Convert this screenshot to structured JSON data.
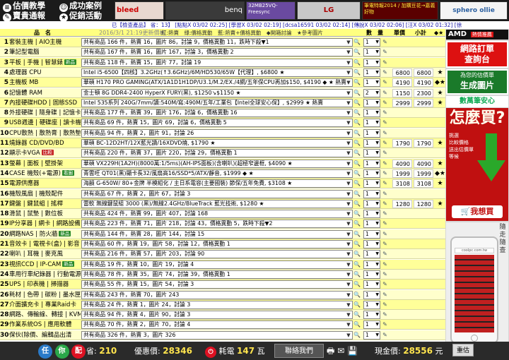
{
  "header": {
    "nav": [
      {
        "label": "估價教學",
        "icon": "document-icon"
      },
      {
        "label": "成功案例",
        "icon": "smiley-icon"
      },
      {
        "label": "賣貴通報",
        "icon": "edit-icon"
      },
      {
        "label": "促銷活動",
        "icon": "star-icon"
      }
    ],
    "ads": [
      {
        "text": "bleed",
        "bg": "#e8d8d0",
        "color": "#c00"
      },
      {
        "text": "benq",
        "bg": "#3a3a3a",
        "color": "#fff"
      },
      {
        "text": "32MB25VQ- Freesync",
        "bg": "#6a4aa0",
        "color": "#fff"
      },
      {
        "text": "LG",
        "bg": "#c8c8c8",
        "color": "#a00"
      },
      {
        "text": "筆電特報2014 / 加購豆花→嘉義好物",
        "bg": "#5a0000",
        "color": "#ffeb3b"
      },
      {
        "text": "sphero ollie",
        "bg": "#f4f4f4",
        "color": "#2a5fa0"
      }
    ],
    "info": "已【檢查產品】 省：13】 [點點X 03/02 02:25] [學習X 03/02 02:19] [dcsa16591 03/02 02:14] [傳說X 03/02 02:06] [汪X 03/02 01:32] [徐"
  },
  "table": {
    "headers": {
      "name": "品　名",
      "date": "2016/3/1 21:19更新價格",
      "legend": "紅:熱賣　綠:價格異動　藍:熱賣+價格異動　◆開箱討論　★參考圖片",
      "qty": "數　量",
      "unit": "單價",
      "subtotal": "小計",
      "stars": "◆★"
    },
    "rows": [
      {
        "n": "1",
        "cat": "套裝主機 | AIO主機",
        "product": "共有商品 166 件，熱賣 16，圖片 86，討論 9，價格異動 11，跌時下殺▼1",
        "qty": "1",
        "unit": "",
        "subtotal": "",
        "mark": ""
      },
      {
        "n": "2",
        "cat": "筆記型電腦",
        "product": "共有商品 167 件，熱賣 16，圖片 167，討論 3，價格異動 2",
        "qty": "1",
        "unit": "",
        "subtotal": "",
        "mark": ""
      },
      {
        "n": "3",
        "cat": "平板 | 手機 | 智慧錶",
        "tag": "新品",
        "tagColor": "green",
        "product": "共有商品 118 件，熱賣 15，圖片 77，討論 19",
        "qty": "1",
        "unit": "",
        "subtotal": "",
        "mark": ""
      },
      {
        "n": "4",
        "cat": "處理器 CPU",
        "product": "Intel i5-6500【四核】3.2GHz(↑3.6GHz)/6M/HD530/65W【代理】, $6800 ★",
        "qty": "1",
        "unit": "6800",
        "subtotal": "6800",
        "mark": "★"
      },
      {
        "n": "5",
        "cat": "主機板 MB",
        "product": "華碩 H170 PRO GAMING(ATX/1A1D1H1DP/U3.1/M.2/EX./4網/五年保CPU再加$150, $4190 ◆ ★ 熱賣",
        "qty": "1",
        "unit": "4190",
        "subtotal": "4190",
        "mark": "◆★"
      },
      {
        "n": "6",
        "cat": "記憶體 RAM",
        "product": "金士頓 8G DDR4-2400 HyperX FURY(黑), $1250↘$1150 ★",
        "qty": "2",
        "unit": "1150",
        "subtotal": "2300",
        "mark": "★"
      },
      {
        "n": "7",
        "cat": "內接硬碟HDD | 固態SSD",
        "product": "Intel 535系列 240G/7mm/讀:540M/寫:490M/五年/工業包【Intel全球安心保】, $2999 ★ 熱賣",
        "qty": "1",
        "unit": "2999",
        "subtotal": "2999",
        "mark": "★"
      },
      {
        "n": "8",
        "cat": "外接硬碟 | 隨身碟 | 記憶卡",
        "product": "共有商品 177 件，熱賣 39，圖片 176，討論 6，價格異動 16",
        "qty": "1",
        "unit": "",
        "subtotal": "",
        "mark": ""
      },
      {
        "n": "9",
        "cat": "USB週邊 | 硬碟座 | 讀卡機",
        "product": "共有商品 69 件，熱賣 15，圖片 69，討論 6，價格異動 5",
        "qty": "1",
        "unit": "",
        "subtotal": "",
        "mark": ""
      },
      {
        "n": "10",
        "cat": "CPU散熱 | 散熱膏 | 散熱墊",
        "product": "共有商品 94 件，熱賣 2，圖片 91，討論 26",
        "qty": "1",
        "unit": "",
        "subtotal": "",
        "mark": ""
      },
      {
        "n": "11",
        "cat": "燒錄器 CD/DVD/BD",
        "product": "華碩 BC-12D2HT/12X藍光讀/16XDVD燒, $1790 ★",
        "qty": "1",
        "unit": "1790",
        "subtotal": "1790",
        "mark": "★"
      },
      {
        "n": "12",
        "cat": "顯示卡VGA",
        "tag": "比較",
        "tagColor": "red",
        "product": "共有商品 220 件，熱賣 37，圖片 220，討論 29，價格異動 1",
        "qty": "1",
        "unit": "",
        "subtotal": "",
        "mark": ""
      },
      {
        "n": "13",
        "cat": "螢幕 | 面板 | 壁掛架",
        "product": "華碩 VX229H(1A2H)(8000萬:1/5ms)(AH-IPS面板)(含喇叭)(超極窄邊框, $4090 ★",
        "qty": "1",
        "unit": "4090",
        "subtotal": "4090",
        "mark": "★"
      },
      {
        "n": "14",
        "cat": "CASE 機殼(+電源)",
        "tag": "看圖",
        "tagColor": "green",
        "product": "青雲旺 QT01(黑)顯卡長32/風扇高16/SSD*5/ATX/靜音, $1999 ◆ ★",
        "qty": "1",
        "unit": "1999",
        "subtotal": "1999",
        "mark": "◆★"
      },
      {
        "n": "15",
        "cat": "電源供應器",
        "product": "海韻 G-650W/ 80+金牌 半模組化 / 主日系電容(主要國裝) 節保/五年免費, $3108 ★",
        "qty": "1",
        "unit": "3108",
        "subtotal": "3108",
        "mark": "★"
      },
      {
        "n": "16",
        "cat": "機殼風扇 | 機殼配件",
        "product": "共有商品 67 件，熱賣 2，圖片 67，討論 3",
        "qty": "1",
        "unit": "",
        "subtotal": "",
        "mark": ""
      },
      {
        "n": "17",
        "cat": "鍵盤 | 鍵鼠組 | 搖桿",
        "product": "雷軟 無線鍵鼠組 3000 (黑)/無線2.4GHz/BlueTrack 藍光技術, $1280 ★",
        "qty": "1",
        "unit": "1280",
        "subtotal": "1280",
        "mark": "★"
      },
      {
        "n": "18",
        "cat": "滑鼠 | 鼠墊 | 數位板",
        "product": "共有商品 424 件，熱賣 99，圖片 407，討論 168",
        "qty": "1",
        "unit": "",
        "subtotal": "",
        "mark": ""
      },
      {
        "n": "19",
        "cat": "IP分享器 | 網卡 | 網路設備",
        "product": "共有商品 223 件，熱賣 71，圖片 218，討論 43，價格異動 5，跌時下殺▼2",
        "qty": "1",
        "unit": "",
        "subtotal": "",
        "mark": ""
      },
      {
        "n": "20",
        "cat": "網路NAS | 防火牆",
        "tag": "新品",
        "tagColor": "green",
        "product": "共有商品 144 件，熱賣 28，圖片 144，討論 15",
        "qty": "1",
        "unit": "",
        "subtotal": "",
        "mark": ""
      },
      {
        "n": "21",
        "cat": "音效卡 | 電視卡(盒) | 影音",
        "product": "共有商品 60 件，熱賣 19，圖片 58，討論 12，價格異動 1",
        "qty": "1",
        "unit": "",
        "subtotal": "",
        "mark": ""
      },
      {
        "n": "22",
        "cat": "喇叭 | 耳機 | 麥克風",
        "product": "共有商品 216 件，熱賣 57，圖片 203，討論 90",
        "qty": "1",
        "unit": "",
        "subtotal": "",
        "mark": ""
      },
      {
        "n": "23",
        "cat": "視訊CCD | IP-CAM",
        "tag": "新品",
        "tagColor": "green",
        "product": "共有商品 19 件，熱賣 10，圖片 19，討論 4",
        "qty": "1",
        "unit": "",
        "subtotal": "",
        "mark": ""
      },
      {
        "n": "24",
        "cat": "車用行車紀錄器 | 行動電源",
        "product": "共有商品 78 件，熱賣 35，圖片 74，討論 39，價格異動 1",
        "qty": "1",
        "unit": "",
        "subtotal": "",
        "mark": ""
      },
      {
        "n": "25",
        "cat": "UPS | 印表機 | 掃描器",
        "product": "共有商品 55 件，熱賣 15，圖片 54，討論 3",
        "qty": "1",
        "unit": "",
        "subtotal": "",
        "mark": ""
      },
      {
        "n": "26",
        "cat": "耗材 | 色帶 | 碳粉 | 墨水匣",
        "product": "共有商品 243 件，熱賣 70，圖片 243",
        "qty": "1",
        "unit": "",
        "subtotal": "",
        "mark": ""
      },
      {
        "n": "27",
        "cat": "介面擴充卡 | 專業Raid卡",
        "product": "共有商品 24 件，熱賣 1，圖片 24，討論 3",
        "qty": "1",
        "unit": "",
        "subtotal": "",
        "mark": ""
      },
      {
        "n": "28",
        "cat": "網路、傳輸線、轉接 | KVM",
        "product": "共有商品 94 件，熱賣 4，圖片 90，討論 3",
        "qty": "1",
        "unit": "",
        "subtotal": "",
        "mark": ""
      },
      {
        "n": "29",
        "cat": "作業系統OS | 應用軟體",
        "product": "共有商品 70 件，熱賣 2，圖片 70，討論 4",
        "qty": "1",
        "unit": "",
        "subtotal": "",
        "mark": ""
      },
      {
        "n": "30",
        "cat": "保伙(除價、編輯品出清",
        "product": "共有商品 326 件，熱賣 3，圖片 326",
        "qty": "1",
        "unit": "",
        "subtotal": "",
        "mark": ""
      }
    ]
  },
  "sidebar": {
    "brand": "AMD",
    "brand_sub": "熱情推薦",
    "order_line1": "網路訂單",
    "order_line2": "查詢台",
    "quote_line1": "為您的估價單",
    "quote_line2": "生成圖片",
    "slogan": "數萬筆安心",
    "promo_big": "怎麼買?",
    "promo_steps": [
      "挑選",
      "比較價格",
      "送出估價單",
      "等候"
    ],
    "buy_button": "我想買",
    "mobile_label": "隨走隨查",
    "phone_url": "coolpc.com.tw"
  },
  "footer": {
    "icons": [
      "任",
      "你",
      "配"
    ],
    "qty_label": "省:",
    "qty_value": "210",
    "discount_label": "優惠價:",
    "discount_value": "28346",
    "power_label": "耗電",
    "power_value": "147",
    "power_unit": "瓦",
    "contact": "聯絡我們",
    "cash_label": "現金價:",
    "cash_value": "28556",
    "cash_unit": "元",
    "reset": "重估"
  },
  "colors": {
    "accent": "#ffff99",
    "hot": "#c00000",
    "green": "#2a8a2a",
    "order": "#d11"
  }
}
